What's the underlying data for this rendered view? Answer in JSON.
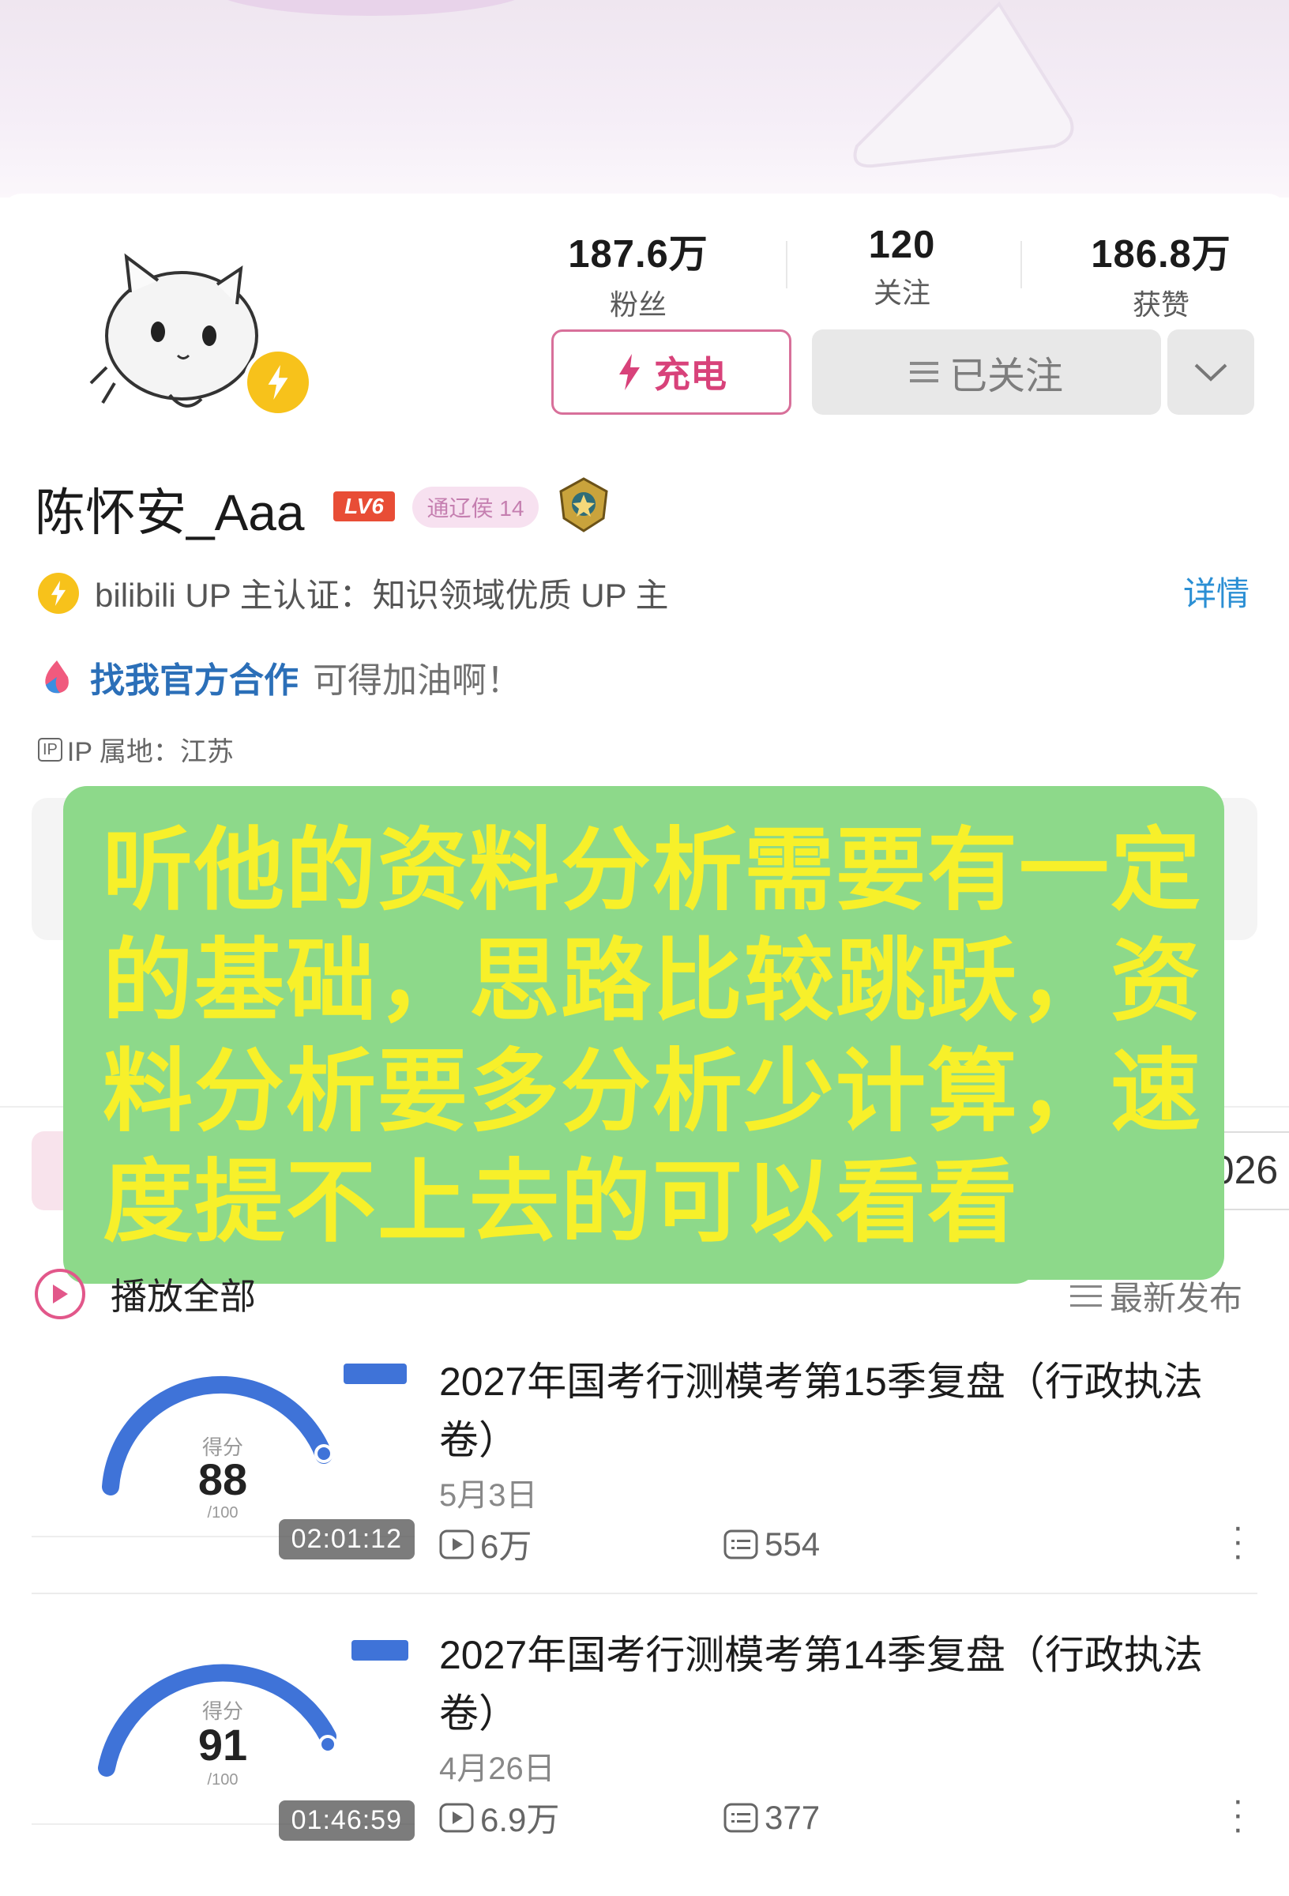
{
  "stats": [
    {
      "num": "187.6万",
      "label": "粉丝"
    },
    {
      "num": "120",
      "label": "关注"
    },
    {
      "num": "186.8万",
      "label": "获赞"
    }
  ],
  "actions": {
    "charge": "充电",
    "follow": "已关注"
  },
  "profile": {
    "name": "陈怀安_Aaa",
    "level": "LV6",
    "fan_badge": "通辽侯 14",
    "verify": "bilibili UP 主认证：知识领域优质 UP 主",
    "detail": "详情",
    "coop_link": "找我官方合作",
    "coop_text": "可得加油啊！",
    "ip": "IP 属地：江苏"
  },
  "tabs_partial": {
    "dots": "..",
    "year": "2026"
  },
  "overlay": {
    "lines": [
      "听他的资料分析需要有一定",
      "的基础，思路比较跳跃，资",
      "料分析要多分析少计算，速",
      "度提不上去的可以看看"
    ]
  },
  "list": {
    "play_all": "播放全部",
    "sort": "最新发布"
  },
  "videos": [
    {
      "title": "2027年国考行测模考第15季复盘（行政执法卷）",
      "date": "5月3日",
      "views": "6万",
      "comments": "554",
      "duration": "02:01:12",
      "score": "88",
      "score_label": "得分",
      "score_max": "/100"
    },
    {
      "title": "2027年国考行测模考第14季复盘（行政执法卷）",
      "date": "4月26日",
      "views": "6.9万",
      "comments": "377",
      "duration": "01:46:59",
      "score": "91",
      "score_label": "得分",
      "score_max": "/100"
    }
  ],
  "colors": {
    "accent": "#d8427a",
    "link": "#2b8fd4",
    "overlay_bg": "#8dd98a",
    "overlay_text": "#f7f02a"
  }
}
